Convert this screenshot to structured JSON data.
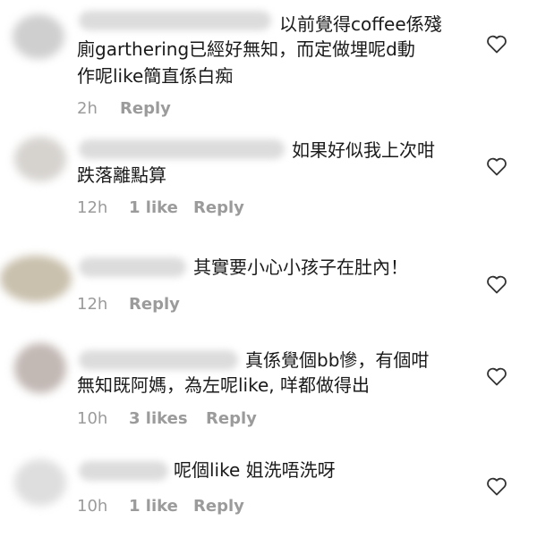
{
  "comments": [
    {
      "text_lines": [
        "以前覺得coffee係殘",
        "廁garthering已經好無知，而定做埋呢d動",
        "作呢like簡直係白痴"
      ],
      "time": "2h",
      "likes": "",
      "reply_label": "Reply"
    },
    {
      "text_lines": [
        "如果好似我上次咁",
        "跌落離點算"
      ],
      "time": "12h",
      "likes": "1 like",
      "reply_label": "Reply"
    },
    {
      "text_lines": [
        "其實要小心小孩子在肚內！"
      ],
      "time": "12h",
      "likes": "",
      "reply_label": "Reply"
    },
    {
      "text_lines": [
        "真係覺個bb慘，有個咁",
        "無知既阿媽，為左呢like, 咩都做得出"
      ],
      "time": "10h",
      "likes": "3 likes",
      "reply_label": "Reply"
    },
    {
      "text_lines": [
        "呢個like 姐洗唔洗呀"
      ],
      "time": "10h",
      "likes": "1 like",
      "reply_label": "Reply"
    }
  ],
  "icons": {
    "like": "heart-outline-icon"
  },
  "colors": {
    "text": "#1a1a1a",
    "meta": "#9b9b9b",
    "heart": "#333333"
  }
}
